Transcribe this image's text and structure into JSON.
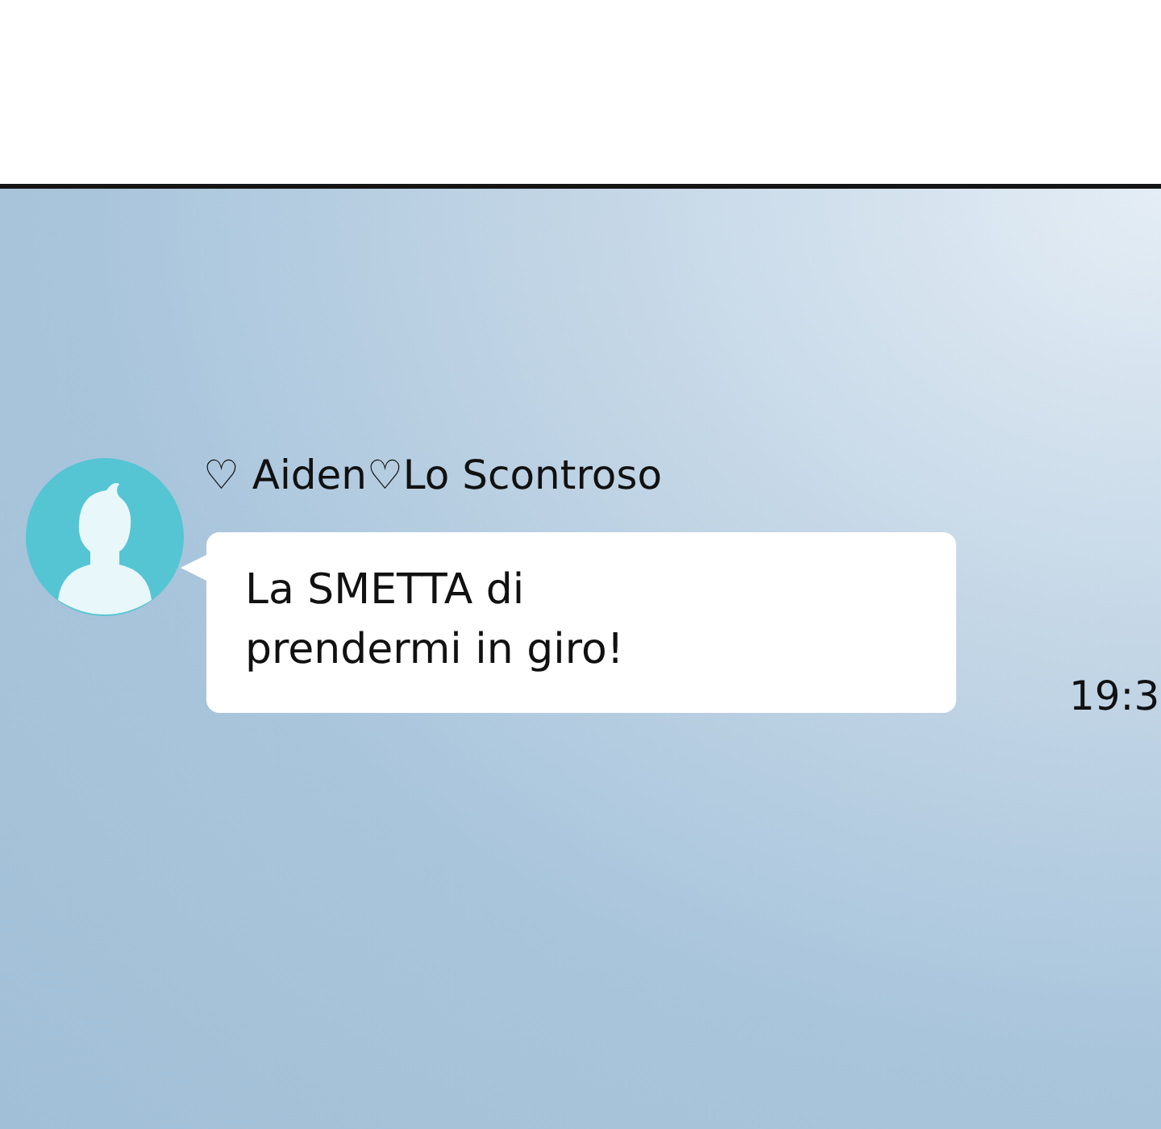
{
  "chat": {
    "sender": {
      "name": "♡ Aiden♡Lo Scontroso"
    },
    "messages": [
      {
        "text": "La SMETTA di\nprendermi in giro!",
        "time": "19:3"
      }
    ]
  }
}
